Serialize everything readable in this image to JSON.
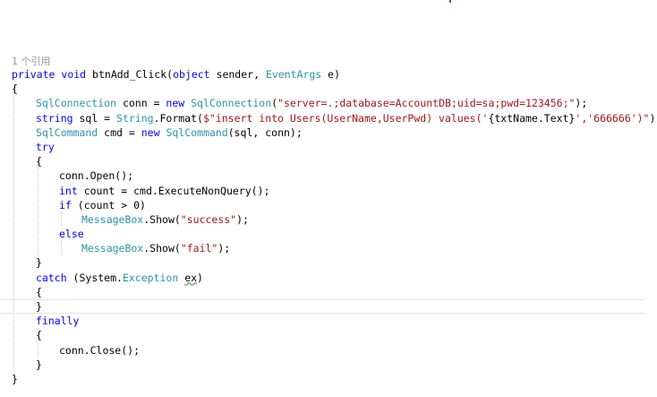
{
  "codelens": {
    "text": "1 个引用"
  },
  "code": {
    "l1": {
      "kw1": "private",
      "kw2": "void",
      "name": "btnAdd_Click(",
      "kw3": "object",
      "rest1": " sender, ",
      "ty1": "EventArgs",
      "rest2": " e)"
    },
    "l2": {
      "text": "{"
    },
    "l3": {
      "ty1": "SqlConnection",
      "t1": " conn = ",
      "kw1": "new",
      "t2": " ",
      "ty2": "SqlConnection",
      "t3": "(",
      "str": "\"server=.;database=AccountDB;uid=sa;pwd=123456;\"",
      "t4": ");"
    },
    "l4": {
      "kw1": "string",
      "t1": " sql = ",
      "ty1": "String",
      "t2": ".Format(",
      "str1": "$\"insert into Users(UserName,UserPwd) values('",
      "t3": "{txtName.Text}",
      "str2": "','666666')\"",
      "t4": ");"
    },
    "l5": {
      "ty1": "SqlCommand",
      "t1": " cmd = ",
      "kw1": "new",
      "t2": " ",
      "ty2": "SqlCommand",
      "t3": "(sql, conn);"
    },
    "l6": {
      "kw1": "try"
    },
    "l7": {
      "text": "{"
    },
    "l8": {
      "text": "conn.Open();"
    },
    "l9": {
      "kw1": "int",
      "t1": " count = cmd.ExecuteNonQuery();"
    },
    "l10": {
      "kw1": "if",
      "t1": " (count > 0)"
    },
    "l11": {
      "ty1": "MessageBox",
      "t1": ".Show(",
      "str": "\"success\"",
      "t2": ");"
    },
    "l12": {
      "kw1": "else"
    },
    "l13": {
      "ty1": "MessageBox",
      "t1": ".Show(",
      "str": "\"fail\"",
      "t2": ");"
    },
    "l14": {
      "text": "}"
    },
    "l15": {
      "kw1": "catch",
      "t1": " (System.",
      "ty1": "Exception",
      "t2": " ",
      "var": "ex",
      "t3": ")"
    },
    "l16": {
      "text": "{"
    },
    "l17": {
      "text": "}"
    },
    "l18": {
      "kw1": "finally"
    },
    "l19": {
      "text": "{"
    },
    "l20": {
      "text": "conn.Close();"
    },
    "l21": {
      "text": "}"
    },
    "l22": {
      "text": "}"
    }
  },
  "colors": {
    "keyword": "#0000ff",
    "type": "#2b91af",
    "string": "#a31515",
    "codelens": "#999999",
    "squiggle": "#2e8b2e"
  }
}
